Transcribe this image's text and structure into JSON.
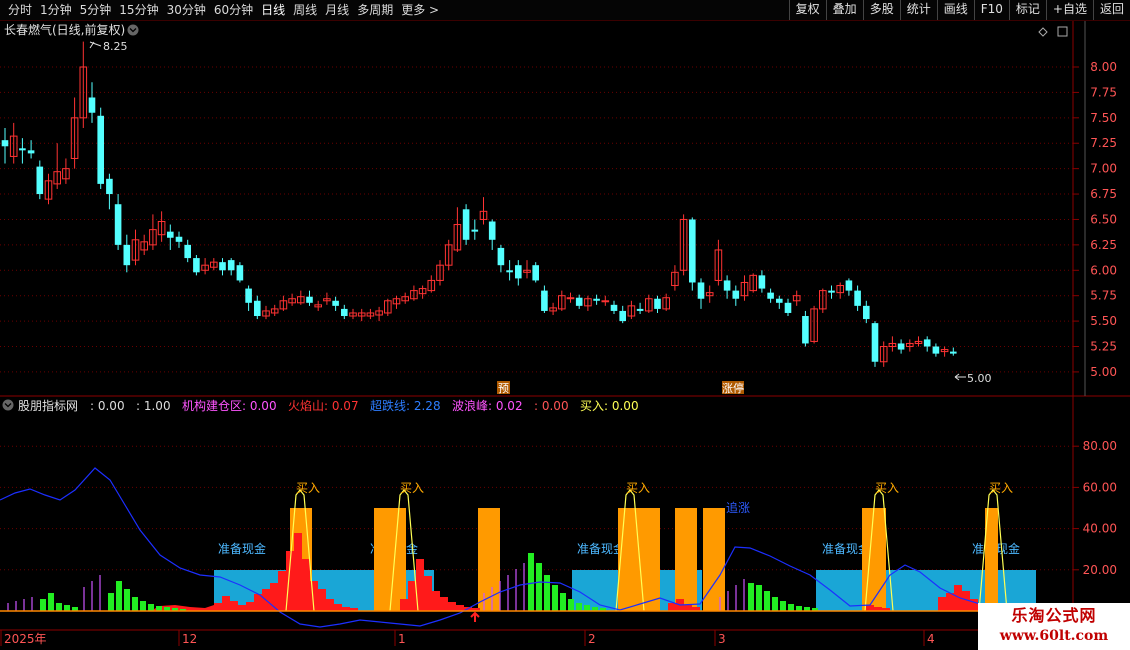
{
  "toolbar": {
    "periods": [
      "分时",
      "1分钟",
      "5分钟",
      "15分钟",
      "30分钟",
      "60分钟",
      "日线",
      "周线",
      "月线",
      "多周期",
      "更多 >"
    ],
    "active_period": "日线",
    "actions": [
      "复权",
      "叠加",
      "多股",
      "统计",
      "画线",
      "F10",
      "标记",
      "+自选",
      "返回"
    ]
  },
  "main_chart": {
    "title": "长春燃气(日线,前复权)",
    "high_label": "8.25",
    "low_label": "5.00",
    "y_ticks": [
      "8.00",
      "7.75",
      "7.50",
      "7.25",
      "7.00",
      "6.75",
      "6.50",
      "6.25",
      "6.00",
      "5.75",
      "5.50",
      "5.25",
      "5.00"
    ],
    "markers": [
      "预",
      "涨停"
    ],
    "colors": {
      "up": "#ff3333",
      "down": "#54ffff",
      "bg": "#000000",
      "grid": "#6a0000"
    }
  },
  "indicator": {
    "name": "股朋指标网",
    "values": [
      {
        "text": ": 0.00",
        "color": "#dddddd"
      },
      {
        "text": ": 1.00",
        "color": "#dddddd"
      },
      {
        "text": "机构建仓区: 0.00",
        "color": "#ff55ff"
      },
      {
        "text": "火焰山: 0.07",
        "color": "#ff3333"
      },
      {
        "text": "超跌线: 2.28",
        "color": "#2d7dff"
      },
      {
        "text": "波浪峰: 0.02",
        "color": "#ff55ff"
      },
      {
        "text": ": 0.00",
        "color": "#ff5555"
      },
      {
        "text": "买入: 0.00",
        "color": "#ffff55"
      }
    ],
    "y_ticks": [
      "80.00",
      "60.00",
      "40.00",
      "20.00"
    ],
    "buy_label": "买入",
    "cash_label": "准备现金",
    "chase_label": "追涨"
  },
  "x_axis": {
    "labels": [
      "2025年",
      "12",
      "1",
      "2",
      "3",
      "4"
    ]
  },
  "watermark": {
    "line1": "乐淘公式网",
    "line2": "www.60lt.com"
  }
}
